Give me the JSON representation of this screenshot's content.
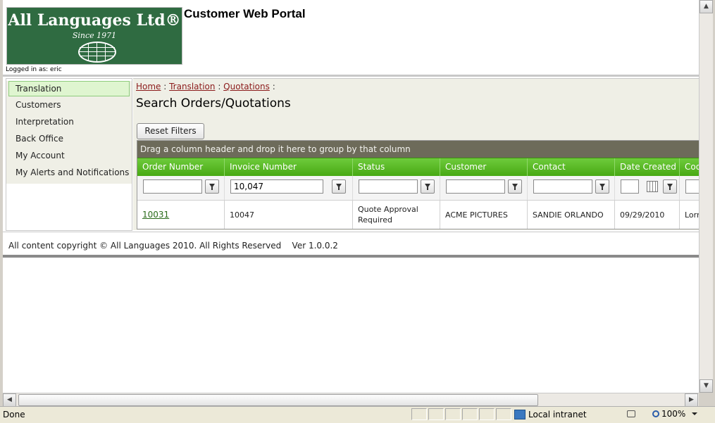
{
  "logo": {
    "name": "All Languages Ltd®",
    "since": "Since 1971"
  },
  "portal_title": "Customer Web Portal",
  "logged_in": "Logged in as: eric",
  "sidebar": {
    "items": [
      {
        "label": "Translation",
        "active": true
      },
      {
        "label": "Customers"
      },
      {
        "label": "Interpretation"
      },
      {
        "label": "Back Office"
      },
      {
        "label": "My Account"
      },
      {
        "label": "My Alerts and Notifications"
      }
    ]
  },
  "breadcrumb": {
    "items": [
      "Home",
      "Translation",
      "Quotations"
    ],
    "separator": " : ",
    "trailing": " :"
  },
  "page_title": "Search Orders/Quotations",
  "reset_button": "Reset Filters",
  "grid": {
    "group_hint": "Drag a column header and drop it here to group by that column",
    "columns": [
      "Order Number",
      "Invoice Number",
      "Status",
      "Customer",
      "Contact",
      "Date Created",
      "Coo"
    ],
    "filters": {
      "invoice_number": "10,047"
    },
    "rows": [
      {
        "order_number": "10031",
        "invoice_number": "10047",
        "status": "Quote Approval Required",
        "customer": "ACME PICTURES",
        "contact": "SANDIE ORLANDO",
        "date_created": "09/29/2010",
        "coordinator": "Lorr"
      }
    ]
  },
  "footer": "All content copyright © All Languages 2010. All Rights Reserved    Ver 1.0.0.2",
  "statusbar": {
    "status": "Done",
    "zone": "Local intranet",
    "zoom": "100%"
  },
  "colors": {
    "header_green": "#48a913",
    "logo_green": "#2f6b41",
    "link_red": "#8b1a1a",
    "group_bar": "#6d6b5a"
  },
  "icons": {
    "filter": "funnel-icon",
    "calendar": "calendar-icon",
    "zone": "intranet-zone-icon",
    "zoom": "zoom-icon"
  }
}
